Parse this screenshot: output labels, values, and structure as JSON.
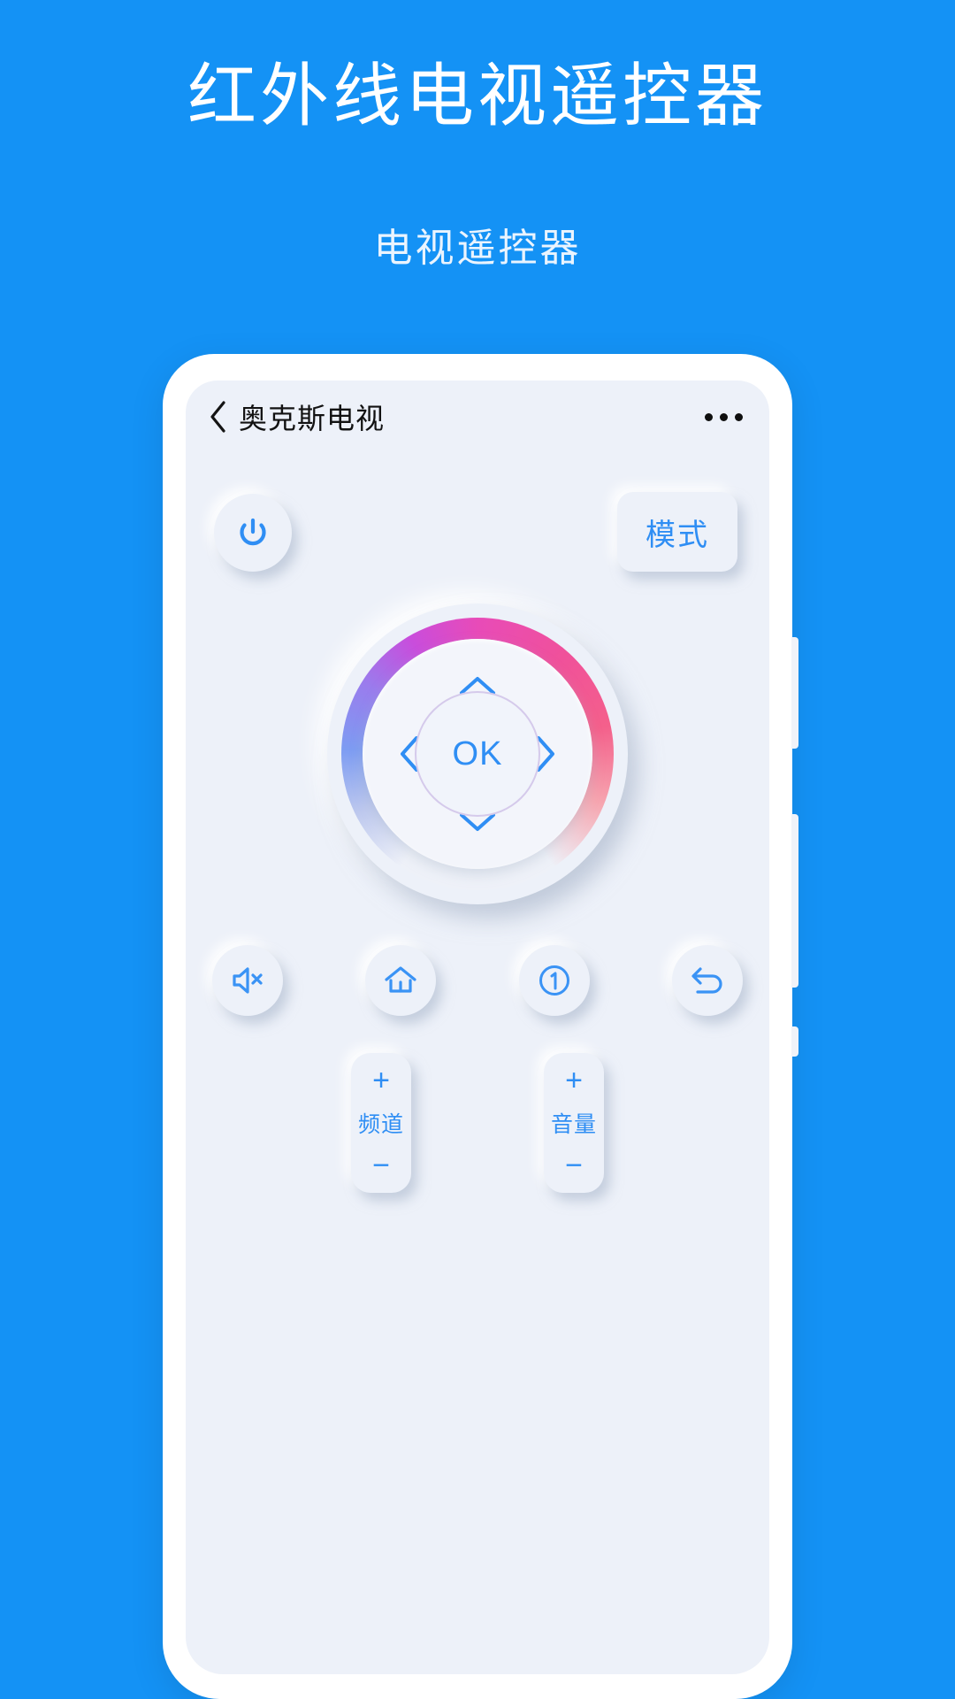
{
  "promo": {
    "title": "红外线电视遥控器",
    "subtitle": "电视遥控器"
  },
  "colors": {
    "background": "#1492F5",
    "screen": "#EDF1F9",
    "accent_blue": "#2F8EF4",
    "ring_pink": "#E84BB8",
    "ring_blue": "#7D9CF2"
  },
  "appbar": {
    "back_icon": "chevron-left-icon",
    "title": "奥克斯电视",
    "more_icon": "more-horizontal-icon"
  },
  "controls": {
    "power_icon": "power-icon",
    "mode_label": "模式",
    "dpad": {
      "ok_label": "OK",
      "up_icon": "chevron-up-icon",
      "down_icon": "chevron-down-icon",
      "left_icon": "chevron-left-icon",
      "right_icon": "chevron-right-icon"
    },
    "functions": [
      {
        "name": "mute-button",
        "icon": "speaker-mute-icon"
      },
      {
        "name": "home-button",
        "icon": "home-icon"
      },
      {
        "name": "info-button",
        "icon": "circled-one-icon"
      },
      {
        "name": "back-button",
        "icon": "return-arrow-icon"
      }
    ],
    "rockers": [
      {
        "name": "channel-rocker",
        "plus": "+",
        "label": "频道",
        "minus": "−"
      },
      {
        "name": "volume-rocker",
        "plus": "+",
        "label": "音量",
        "minus": "−"
      }
    ]
  }
}
